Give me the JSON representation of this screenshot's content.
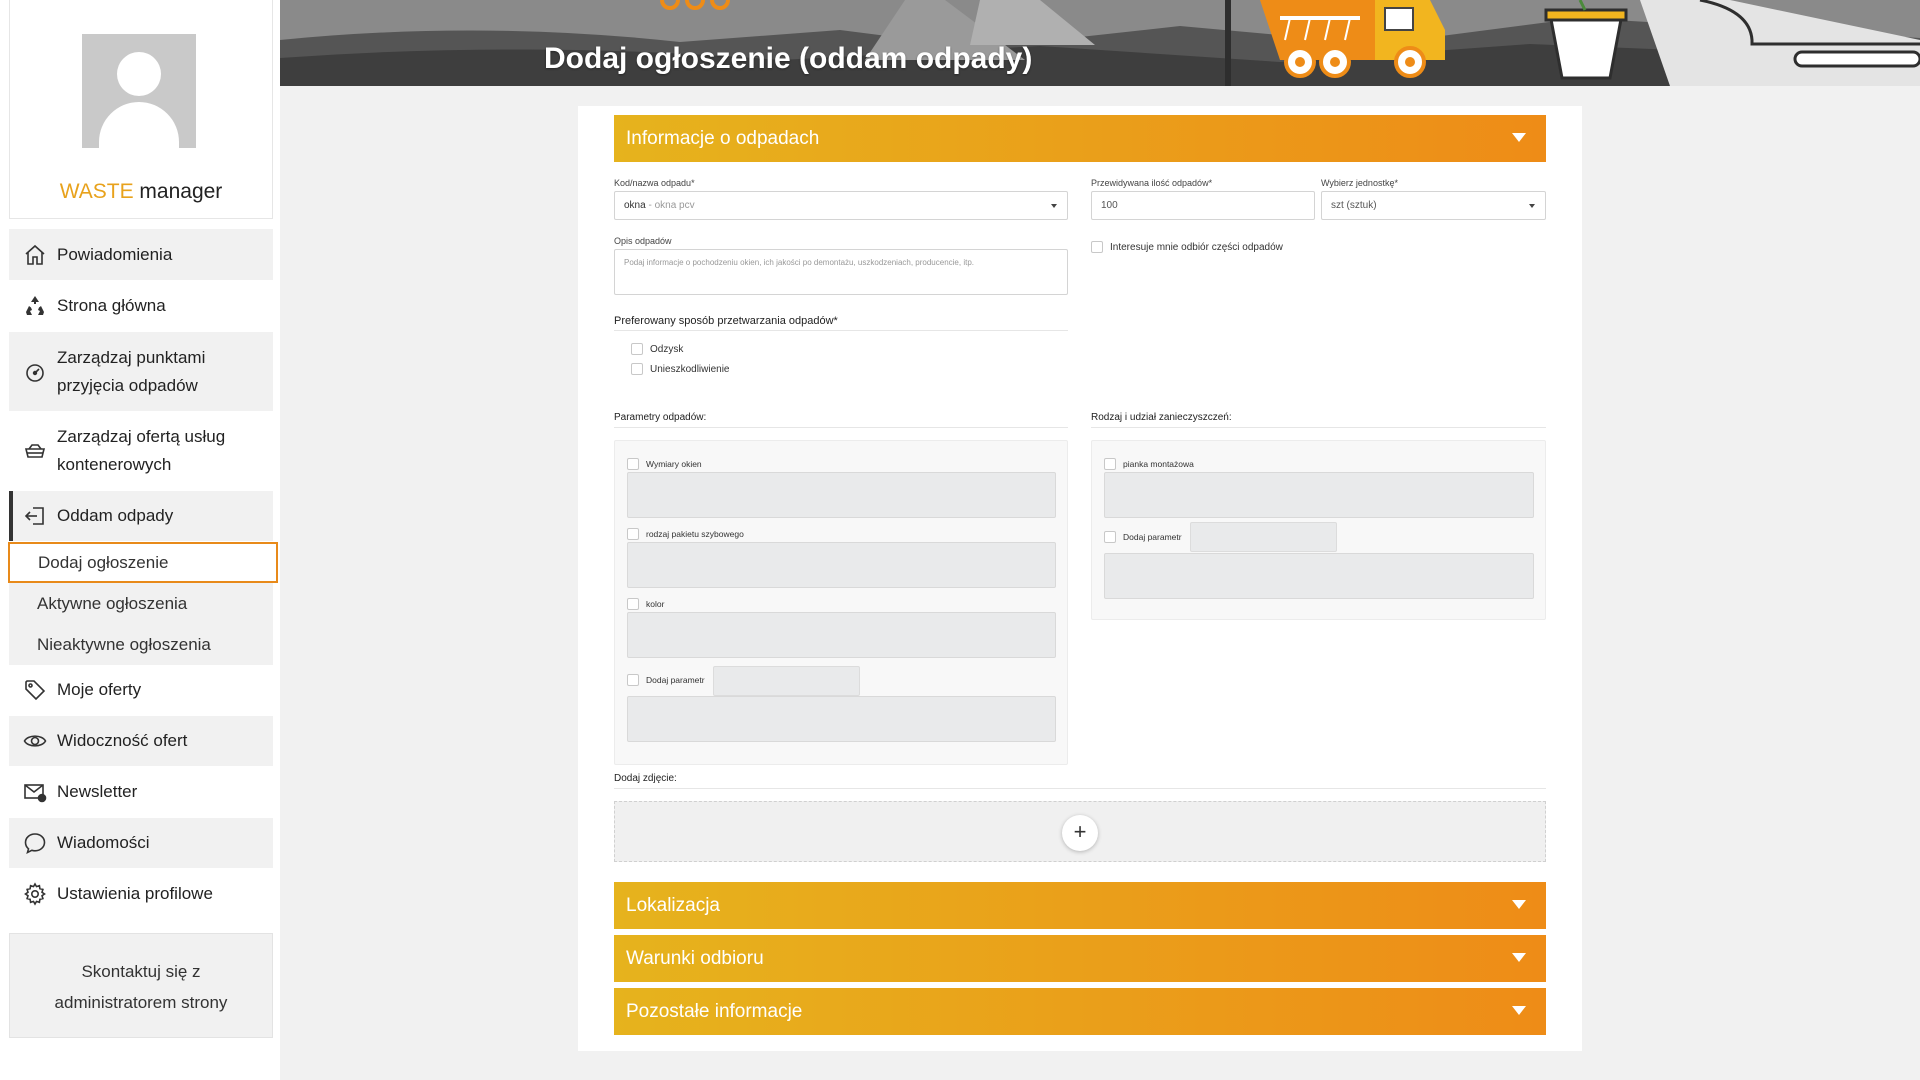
{
  "sidebar": {
    "brand_accent": "WASTE",
    "brand_rest": "manager",
    "menu": [
      {
        "label": "Powiadomienia",
        "icon": "home-icon"
      },
      {
        "label": "Strona główna",
        "icon": "recycle-icon"
      },
      {
        "label": "Zarządzaj punktami przyjęcia odpadów",
        "icon": "gauge-icon"
      },
      {
        "label": "Zarządzaj ofertą usług kontenerowych",
        "icon": "container-icon"
      },
      {
        "label": "Oddam odpady",
        "icon": "sign-in-icon"
      },
      {
        "label": "Moje oferty",
        "icon": "tag-icon"
      },
      {
        "label": "Widoczność ofert",
        "icon": "eye-icon"
      },
      {
        "label": "Newsletter",
        "icon": "envelope-icon"
      },
      {
        "label": "Wiadomości",
        "icon": "chat-bubble-icon"
      },
      {
        "label": "Ustawienia profilowe",
        "icon": "gear-icon"
      }
    ],
    "submenu": [
      {
        "label": "Dodaj ogłoszenie"
      },
      {
        "label": "Aktywne ogłoszenia"
      },
      {
        "label": "Nieaktywne ogłoszenia"
      }
    ],
    "contact": "Skontaktuj się z administratorem strony"
  },
  "header": {
    "title": "Dodaj ogłoszenie (oddam odpady)"
  },
  "sections": {
    "info": "Informacje o odpadach",
    "location": "Lokalizacja",
    "conditions": "Warunki odbioru",
    "other": "Pozostałe informacje"
  },
  "form": {
    "code_label": "Kod/nazwa odpadu*",
    "code_value": "okna",
    "code_sub": " - okna pcv",
    "qty_label": "Przewidywana ilość odpadów*",
    "qty_value": "100",
    "unit_label": "Wybierz jednostkę*",
    "unit_value": "szt (sztuk)",
    "desc_label": "Opis odpadów",
    "desc_placeholder": "Podaj informacje o pochodzeniu okien, ich jakości po demontażu, uszkodzeniach, producencie, itp.",
    "partial_label": "Interesuje mnie odbiór części odpadów",
    "method_label": "Preferowany sposób przetwarzania odpadów*",
    "method_options": [
      "Odzysk",
      "Unieszkodliwienie"
    ],
    "params_label": "Parametry odpadów:",
    "params": [
      "Wymiary okien",
      "rodzaj pakietu szybowego",
      "kolor",
      "Dodaj parametr"
    ],
    "contam_label": "Rodzaj i udział zanieczyszczeń:",
    "contam": [
      "pianka montażowa",
      "Dodaj parametr"
    ],
    "photo_label": "Dodaj zdjęcie:",
    "plus": "+"
  },
  "colors": {
    "accent": "#e88a1a",
    "gradient_start": "#e6b31d",
    "gradient_end": "#ee8c17",
    "truck": "#f2b51f"
  }
}
